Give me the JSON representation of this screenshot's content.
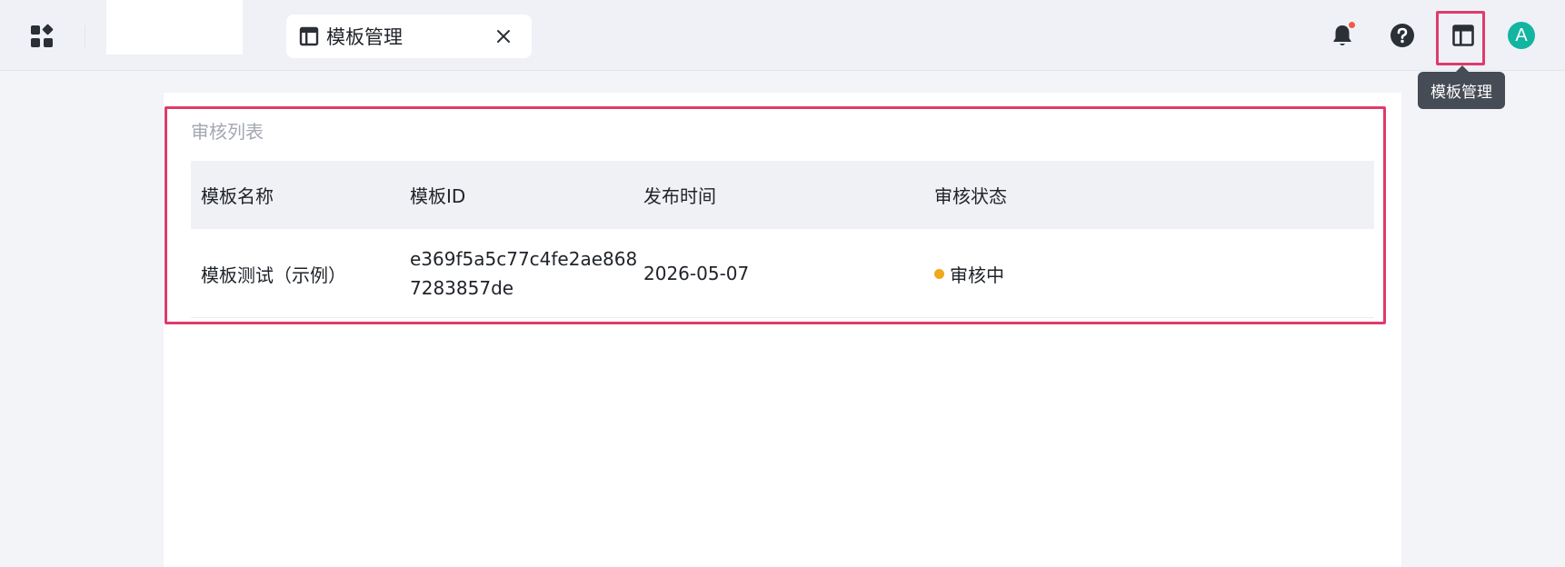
{
  "header": {
    "tab_label": "模板管理",
    "tooltip": "模板管理",
    "avatar_letter": "A"
  },
  "icons": {
    "apps": "apps-grid-icon",
    "tab": "layout-template-icon",
    "close": "close-icon",
    "bell": "bell-icon",
    "help": "help-circle-icon",
    "layout": "layout-template-icon"
  },
  "colors": {
    "highlight": "#e03a6c",
    "avatar_bg": "#12b5a0",
    "status_pending": "#f0a81c",
    "notification_dot": "#f05a4a"
  },
  "review": {
    "title": "审核列表",
    "columns": [
      "模板名称",
      "模板ID",
      "发布时间",
      "审核状态"
    ],
    "rows": [
      {
        "name": "模板测试（示例）",
        "id": "e369f5a5c77c4fe2ae8687283857de",
        "date": "2026-05-07",
        "status": "审核中"
      }
    ]
  }
}
